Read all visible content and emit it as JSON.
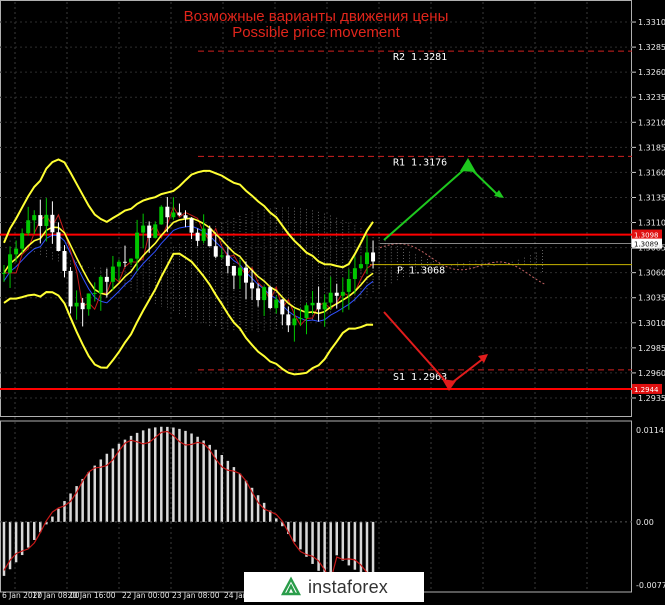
{
  "chart_data": {
    "type": "candlestick",
    "title_ru": "Возможные варианты движения цены",
    "title_en": "Possible price movement",
    "price_axis": {
      "range": [
        1.2923,
        1.3328
      ],
      "ticks": [
        "1.3310",
        "1.3285",
        "1.3260",
        "1.3235",
        "1.3210",
        "1.3185",
        "1.3160",
        "1.3135",
        "1.3110",
        "1.3085",
        "1.3060",
        "1.3035",
        "1.3010",
        "1.2985",
        "1.2960",
        "1.2935"
      ]
    },
    "levels": [
      {
        "name": "R2",
        "label": "R2  1.3281",
        "value": 1.3281,
        "color": "#d02020"
      },
      {
        "name": "R1",
        "label": "R1  1.3176",
        "value": 1.3176,
        "color": "#d02020"
      },
      {
        "name": "P",
        "label": "P  1.3068",
        "value": 1.3068,
        "color": "#c8b400"
      },
      {
        "name": "S1",
        "label": "S1  1.2963",
        "value": 1.2963,
        "color": "#d02020"
      }
    ],
    "horizontal_lines": [
      {
        "value": 1.3098,
        "tag": "1.3098",
        "color": "#ff0000"
      },
      {
        "value": 1.2944,
        "tag": "1.2944",
        "color": "#ff0000"
      }
    ],
    "current_price": {
      "value": 1.3089,
      "tag": "1.3089"
    },
    "time_labels": [
      "6 Jan 2020",
      "17 Jan 08:00",
      "20 Jan 16:00",
      "22 Jan 00:00",
      "23 Jan 08:00",
      "24 Jan"
    ],
    "oscillator": {
      "ticks": [
        "0.0114",
        "0.00",
        "-0.00778"
      ],
      "range": [
        -0.00778,
        0.0114
      ]
    },
    "colors": {
      "bull": "#00c800",
      "bear": "#ffffff",
      "bands": "#ffff33",
      "up_arrow": "#1ec81e",
      "down_arrow": "#e01c1c"
    }
  },
  "logo": {
    "text": "instaforex"
  }
}
